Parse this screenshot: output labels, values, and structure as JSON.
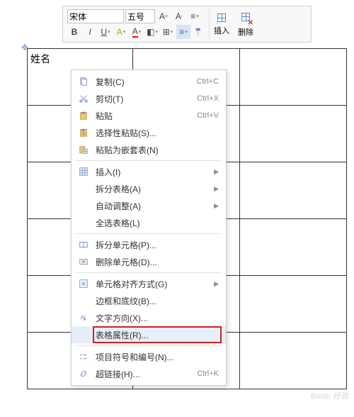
{
  "toolbar": {
    "font_family": "宋体",
    "font_size": "五号",
    "insert_label": "插入",
    "delete_label": "删除"
  },
  "table": {
    "cell_a1": "姓名"
  },
  "context_menu": [
    {
      "icon": "copy",
      "label": "复制(C)",
      "shortcut": "Ctrl+C"
    },
    {
      "icon": "cut",
      "label": "剪切(T)",
      "shortcut": "Ctrl+X"
    },
    {
      "icon": "paste",
      "label": "粘贴",
      "shortcut": "Ctrl+V"
    },
    {
      "icon": "paste-special",
      "label": "选择性粘贴(S)...",
      "shortcut": ""
    },
    {
      "icon": "paste-nested",
      "label": "粘贴为嵌套表(N)",
      "shortcut": ""
    },
    {
      "sep": true
    },
    {
      "icon": "insert-grid",
      "label": "插入(I)",
      "submenu": true
    },
    {
      "icon": "",
      "label": "拆分表格(A)",
      "submenu": true
    },
    {
      "icon": "",
      "label": "自动调整(A)",
      "submenu": true
    },
    {
      "icon": "",
      "label": "全选表格(L)",
      "shortcut": ""
    },
    {
      "sep": true
    },
    {
      "icon": "split-cell",
      "label": "拆分单元格(P)...",
      "shortcut": ""
    },
    {
      "icon": "delete-cell",
      "label": "删除单元格(D)...",
      "shortcut": ""
    },
    {
      "sep": true
    },
    {
      "icon": "align",
      "label": "单元格对齐方式(G)",
      "submenu": true
    },
    {
      "icon": "",
      "label": "边框和底纹(B)...",
      "shortcut": ""
    },
    {
      "icon": "text-dir",
      "label": "文字方向(X)...",
      "shortcut": ""
    },
    {
      "icon": "",
      "label": "表格属性(R)...",
      "shortcut": "",
      "highlight": true
    },
    {
      "sep": true
    },
    {
      "icon": "bullets",
      "label": "项目符号和编号(N)...",
      "shortcut": ""
    },
    {
      "icon": "link",
      "label": "超链接(H)...",
      "shortcut": "Ctrl+K"
    }
  ],
  "watermark": "Baidu 经验"
}
